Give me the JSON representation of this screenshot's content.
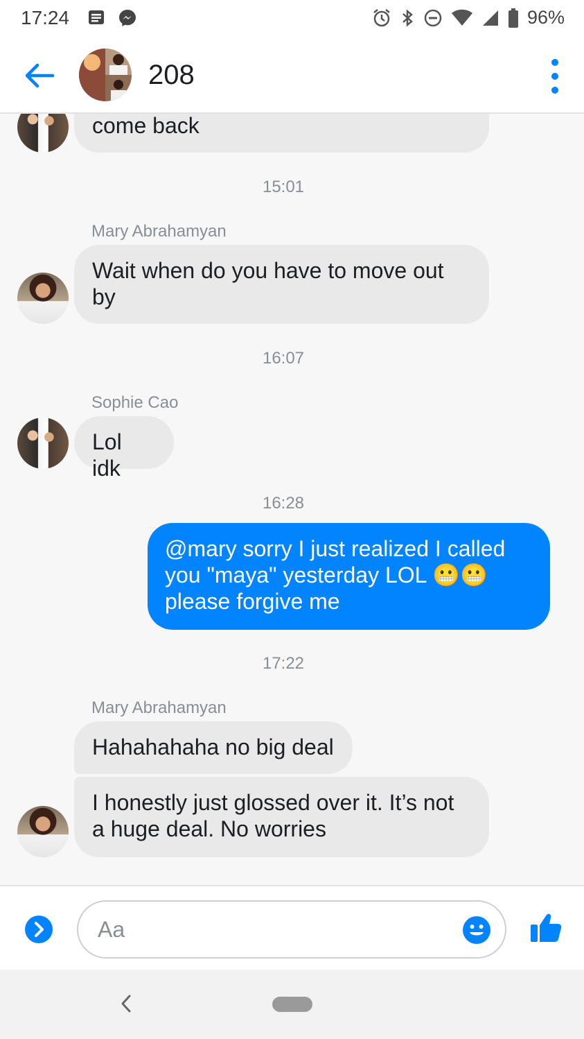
{
  "status_bar": {
    "time": "17:24",
    "battery": "96%",
    "icons": [
      "notes-icon",
      "messenger-icon",
      "alarm-icon",
      "bluetooth-icon",
      "dnd-icon",
      "wifi-icon",
      "signal-icon",
      "battery-icon"
    ]
  },
  "header": {
    "title": "208",
    "back_icon": "arrow-left-icon",
    "menu_icon": "more-vertical-icon"
  },
  "conversation": {
    "partial_message": "come back",
    "timestamps": [
      "15:01",
      "16:07",
      "16:28",
      "17:22"
    ],
    "senders": [
      "Mary Abrahamyan",
      "Sophie Cao",
      "Mary Abrahamyan"
    ],
    "messages": {
      "mary_1": "Wait when do you have to move out by",
      "sophie_1": "Lol idk",
      "me_1": "@mary sorry I just realized I called you \"maya\" yesterday LOL 😬😬 please forgive me",
      "mary_2": "Hahahahaha no big deal",
      "mary_3": "I honestly just glossed over it. It’s not a huge deal. No worries"
    }
  },
  "composer": {
    "placeholder": "Aa",
    "expand_icon": "chevron-right-circle-icon",
    "emoji_icon": "smiley-icon",
    "send_icon": "thumbs-up-icon"
  },
  "colors": {
    "accent": "#0384ff",
    "incoming_bubble": "#e9e9e9",
    "chat_background": "#f7f7f7"
  }
}
